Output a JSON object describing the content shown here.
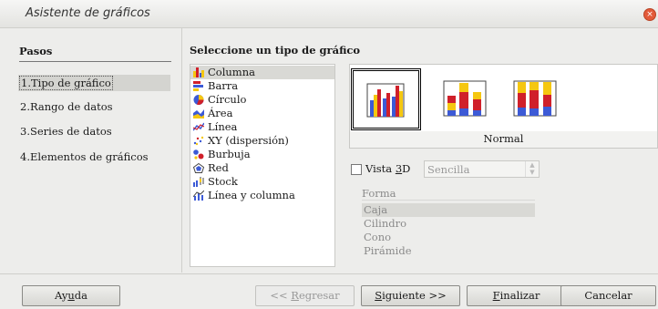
{
  "window": {
    "title": "Asistente de gráficos",
    "close_glyph": "×"
  },
  "steps": {
    "heading": "Pasos",
    "items": [
      {
        "label": "1.Tipo de gráfico",
        "selected": true
      },
      {
        "label": "2.Rango de datos"
      },
      {
        "label": "3.Series de datos"
      },
      {
        "label": "4.Elementos de gráficos"
      }
    ]
  },
  "chart_type": {
    "heading": "Seleccione un tipo de gráfico",
    "types": [
      {
        "label": "Columna",
        "icon": "column-chart-icon",
        "selected": true
      },
      {
        "label": "Barra",
        "icon": "bar-chart-icon"
      },
      {
        "label": "Círculo",
        "icon": "pie-chart-icon"
      },
      {
        "label": "Área",
        "icon": "area-chart-icon"
      },
      {
        "label": "Línea",
        "icon": "line-chart-icon"
      },
      {
        "label": "XY (dispersión)",
        "icon": "scatter-chart-icon"
      },
      {
        "label": "Burbuja",
        "icon": "bubble-chart-icon"
      },
      {
        "label": "Red",
        "icon": "net-chart-icon"
      },
      {
        "label": "Stock",
        "icon": "stock-chart-icon"
      },
      {
        "label": "Línea y columna",
        "icon": "column-line-chart-icon"
      }
    ],
    "subtypes": [
      {
        "icon": "normal-column-icon",
        "selected": true
      },
      {
        "icon": "stacked-column-icon"
      },
      {
        "icon": "percent-stacked-column-icon"
      }
    ],
    "subtype_caption": "Normal"
  },
  "options": {
    "vista3d_label_pre": "Vista ",
    "vista3d_label_key": "3",
    "vista3d_label_post": "D",
    "vista3d_checked": false,
    "vista3d_style": "Sencilla",
    "forma_label": "Forma",
    "shapes": [
      "Caja",
      "Cilindro",
      "Cono",
      "Pirámide"
    ],
    "selected_shape": "Caja"
  },
  "buttons": {
    "help": {
      "pre": "Ay",
      "key": "u",
      "post": "da"
    },
    "back": {
      "pre": "<< ",
      "key": "R",
      "post": "egresar"
    },
    "next": {
      "pre": "",
      "key": "S",
      "post": "iguiente >>"
    },
    "finish": {
      "pre": "",
      "key": "F",
      "post": "inalizar"
    },
    "cancel": {
      "pre": "Cancelar",
      "key": "",
      "post": ""
    }
  },
  "colors": {
    "blue": "#3c5ad6",
    "yellow": "#f5c710",
    "red": "#d0202a"
  }
}
